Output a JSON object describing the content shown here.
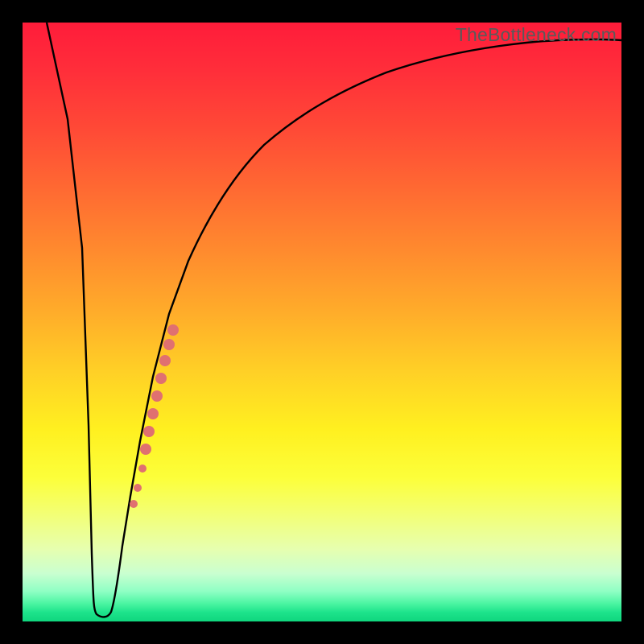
{
  "watermark": "TheBottleneck.com",
  "colors": {
    "frame": "#000000",
    "curve_stroke": "#000000",
    "marker_fill": "#e07070",
    "gradient_top": "#ff1c3a",
    "gradient_bottom": "#0fd67e"
  },
  "chart_data": {
    "type": "line",
    "title": "",
    "xlabel": "",
    "ylabel": "",
    "xlim": [
      0,
      100
    ],
    "ylim": [
      0,
      100
    ],
    "legend": false,
    "grid": false,
    "background": "red-yellow-green vertical gradient",
    "series": [
      {
        "name": "bottleneck-curve",
        "x": [
          0,
          4,
          8,
          10,
          11,
          12,
          13,
          14,
          16,
          18,
          20,
          23,
          26,
          30,
          35,
          40,
          45,
          50,
          56,
          62,
          70,
          78,
          86,
          94,
          100
        ],
        "y": [
          100,
          72,
          40,
          16,
          4,
          1,
          1,
          3,
          10,
          18,
          28,
          40,
          50,
          58,
          66,
          72,
          77,
          81,
          85,
          88,
          91,
          93,
          94.5,
          95.5,
          96
        ]
      }
    ],
    "markers": [
      {
        "name": "highlight-segment",
        "shape": "round",
        "color": "#e07070",
        "points": [
          {
            "x": 18.2,
            "y": 18,
            "r": 5
          },
          {
            "x": 18.8,
            "y": 21,
            "r": 5
          },
          {
            "x": 19.6,
            "y": 25,
            "r": 5
          },
          {
            "x": 20.6,
            "y": 30,
            "r": 7
          },
          {
            "x": 21.2,
            "y": 33,
            "r": 7
          },
          {
            "x": 21.8,
            "y": 36,
            "r": 7
          },
          {
            "x": 22.4,
            "y": 39,
            "r": 7
          },
          {
            "x": 23.0,
            "y": 42,
            "r": 7
          },
          {
            "x": 23.6,
            "y": 45,
            "r": 7
          },
          {
            "x": 24.2,
            "y": 47,
            "r": 7
          },
          {
            "x": 24.8,
            "y": 49,
            "r": 7
          }
        ]
      }
    ]
  }
}
